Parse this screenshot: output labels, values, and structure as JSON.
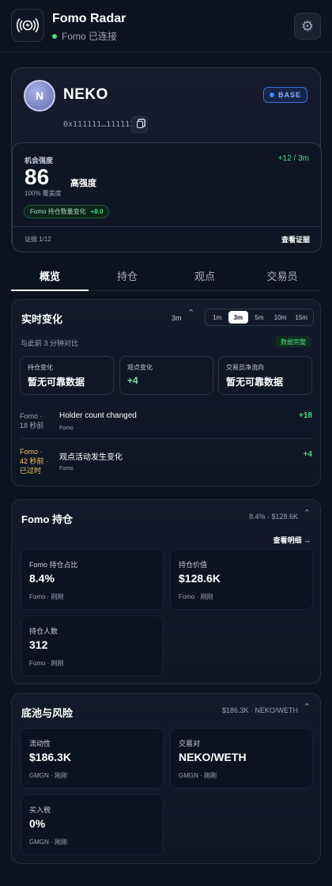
{
  "header": {
    "app_title": "Fomo Radar",
    "connection_status": "Fomo 已连接",
    "status_color": "#4ade80"
  },
  "token": {
    "avatar_letter": "N",
    "name": "NEKO",
    "chain": "BASE",
    "address": "0x111111…111111",
    "strength": {
      "label": "机会强度",
      "delta": "+12 / 3m",
      "score": "86",
      "level": "高强度",
      "coverage": "100% 覆盖度",
      "chip_label": "Fomo 持仓数量变化",
      "chip_value": "+8.0",
      "evidence": "证据 1/12",
      "view_evidence": "查看证据"
    }
  },
  "tabs": [
    {
      "label": "概览",
      "active": true
    },
    {
      "label": "持仓",
      "active": false
    },
    {
      "label": "观点",
      "active": false
    },
    {
      "label": "交易员",
      "active": false
    }
  ],
  "realtime": {
    "title": "实时变化",
    "window": "3m",
    "segments": [
      "1m",
      "3m",
      "5m",
      "10m",
      "15m"
    ],
    "selected": "3m",
    "compare": "与此前 3 分钟对比",
    "badge": "数据完整",
    "cards": [
      {
        "label": "持仓变化",
        "value": "暂无可靠数据"
      },
      {
        "label": "观点变化",
        "value": "+4"
      },
      {
        "label": "交易员净流向",
        "value": "暂无可靠数据"
      }
    ],
    "events": [
      {
        "source_line1": "Fomo ·",
        "source_line2": "18 秒前",
        "source_line3": "",
        "title": "Holder count changed",
        "sub": "Fomo",
        "value": "+18",
        "warn": false
      },
      {
        "source_line1": "Fomo ·",
        "source_line2": "42 秒前 ·",
        "source_line3": "已过时",
        "title": "观点活动发生变化",
        "sub": "Fomo",
        "value": "+4",
        "warn": true
      }
    ]
  },
  "holdings": {
    "title": "Fomo 持仓",
    "meta": "8.4% · $128.6K",
    "details_link": "查看明细 →",
    "cards": [
      {
        "label": "Fomo 持仓占比",
        "value": "8.4%",
        "sub": "Fomo · 刚刚"
      },
      {
        "label": "持仓价值",
        "value": "$128.6K",
        "sub": "Fomo · 刚刚"
      },
      {
        "label": "持仓人数",
        "value": "312",
        "sub": "Fomo · 刚刚"
      }
    ]
  },
  "pool": {
    "title": "底池与风险",
    "meta": "$186.3K · NEKO/WETH",
    "cards": [
      {
        "label": "流动性",
        "value": "$186.3K",
        "sub": "GMGN · 刚刚"
      },
      {
        "label": "交易对",
        "value": "NEKO/WETH",
        "sub": "GMGN · 刚刚"
      },
      {
        "label": "买入税",
        "value": "0%",
        "sub": "GMGN · 刚刚"
      }
    ]
  }
}
